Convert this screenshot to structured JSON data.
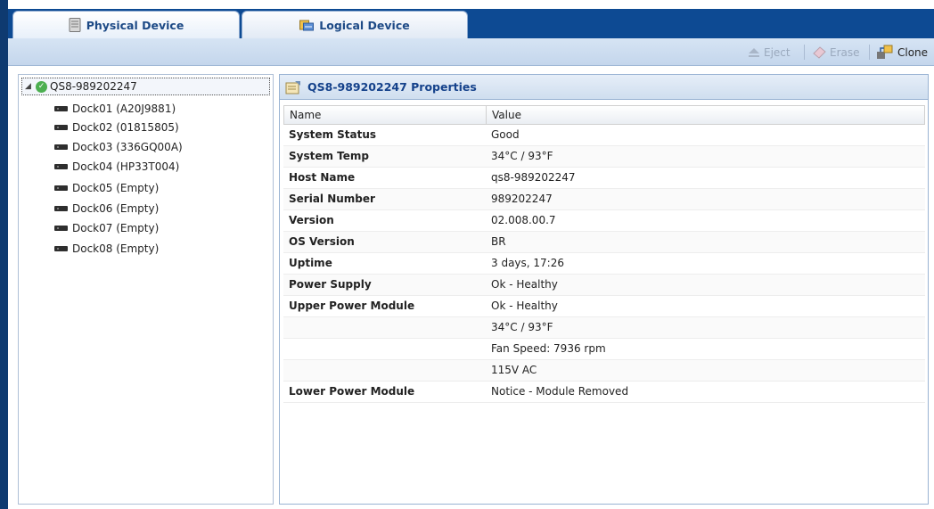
{
  "tabs": [
    {
      "label": "Physical Device",
      "icon": "server-icon",
      "active": true
    },
    {
      "label": "Logical Device",
      "icon": "drives-icon",
      "active": false
    }
  ],
  "toolbar": {
    "eject_label": "Eject",
    "erase_label": "Erase",
    "clone_label": "Clone"
  },
  "tree": {
    "root_label": "QS8-989202247",
    "items": [
      {
        "label": "Dock01 (A20J9881)"
      },
      {
        "label": "Dock02 (01815805)"
      },
      {
        "label": "Dock03 (336GQ00A)"
      },
      {
        "label": "Dock04 (HP33T004)"
      },
      {
        "label": "Dock05 (Empty)"
      },
      {
        "label": "Dock06 (Empty)"
      },
      {
        "label": "Dock07 (Empty)"
      },
      {
        "label": "Dock08 (Empty)"
      }
    ]
  },
  "properties": {
    "title": "QS8-989202247 Properties",
    "columns": {
      "name": "Name",
      "value": "Value"
    },
    "rows": [
      {
        "name": "System Status",
        "value": "Good"
      },
      {
        "name": "System Temp",
        "value": "34°C / 93°F"
      },
      {
        "name": "Host Name",
        "value": "qs8-989202247"
      },
      {
        "name": "Serial Number",
        "value": "989202247"
      },
      {
        "name": "Version",
        "value": "02.008.00.7"
      },
      {
        "name": "OS Version",
        "value": "BR"
      },
      {
        "name": "Uptime",
        "value": "3 days, 17:26"
      },
      {
        "name": "Power Supply",
        "value": "Ok - Healthy"
      },
      {
        "name": "Upper Power Module",
        "value": "Ok - Healthy"
      },
      {
        "name": "",
        "value": "34°C / 93°F"
      },
      {
        "name": "",
        "value": "Fan Speed: 7936 rpm"
      },
      {
        "name": "",
        "value": "115V AC"
      },
      {
        "name": "Lower Power Module",
        "value": "Notice - Module Removed"
      }
    ]
  },
  "colors": {
    "tab_bar": "#0d4a93",
    "header_text": "#15428b",
    "status_ok": "#4caf50"
  }
}
